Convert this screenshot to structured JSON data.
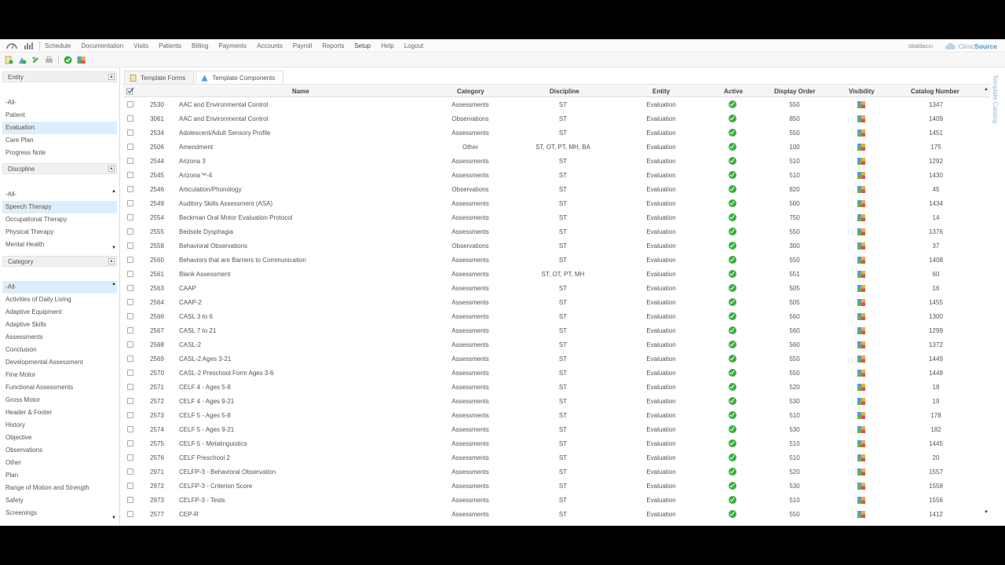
{
  "nav": {
    "items": [
      "Schedule",
      "Documentation",
      "Visits",
      "Patients",
      "Billing",
      "Payments",
      "Accounts",
      "Payroll",
      "Reports",
      "Setup",
      "Help",
      "Logout"
    ],
    "active": "Setup",
    "user": "sbaldacci",
    "brand_prefix": "Clinic",
    "brand_suffix": "Source"
  },
  "toolbar": {
    "icons": [
      "add-form-icon",
      "add-component-icon",
      "edit-icon",
      "print-icon",
      "approve-icon",
      "catalog-icon"
    ]
  },
  "left_panel": {
    "entity": {
      "header": "Entity",
      "items": [
        "-All-",
        "Patient",
        "Evaluation",
        "Care Plan",
        "Progress Note"
      ],
      "selected": "Evaluation"
    },
    "discipline": {
      "header": "Discipline",
      "items": [
        "-All-",
        "Speech Therapy",
        "Occupational Therapy",
        "Physical Therapy",
        "Mental Health"
      ],
      "selected": "Speech Therapy"
    },
    "category": {
      "header": "Category",
      "items": [
        "-All-",
        "Activities of Daily Living",
        "Adaptive Equipment",
        "Adaptive Skills",
        "Assessments",
        "Conclusion",
        "Developmental Assessment",
        "Fine Motor",
        "Functional Assessments",
        "Gross Motor",
        "Header & Footer",
        "History",
        "Objective",
        "Observations",
        "Other",
        "Plan",
        "Range of Motion and Strength",
        "Safety",
        "Screenings"
      ],
      "selected": "-All-"
    }
  },
  "tabs": [
    {
      "label": "Template Forms",
      "active": false
    },
    {
      "label": "Template Components",
      "active": true
    }
  ],
  "side_tab": "Template Catalog",
  "grid": {
    "columns": {
      "name": "Name",
      "category": "Category",
      "discipline": "Discipline",
      "entity": "Entity",
      "active": "Active",
      "display_order": "Display Order",
      "visibility": "Visibility",
      "catalog_number": "Catalog Number"
    },
    "rows": [
      {
        "id": "2530",
        "name": "AAC and Environmental Control",
        "category": "Assessments",
        "discipline": "ST",
        "entity": "Evaluation",
        "order": "550",
        "catalog": "1347"
      },
      {
        "id": "3061",
        "name": "AAC and Environmental Control",
        "category": "Observations",
        "discipline": "ST",
        "entity": "Evaluation",
        "order": "850",
        "catalog": "1409"
      },
      {
        "id": "2534",
        "name": "Adolescent/Adult Sensory Profile",
        "category": "Assessments",
        "discipline": "ST",
        "entity": "Evaluation",
        "order": "550",
        "catalog": "1451"
      },
      {
        "id": "2506",
        "name": "Amendment",
        "category": "Other",
        "discipline": "ST, OT, PT, MH, BA",
        "entity": "Evaluation",
        "order": "100",
        "catalog": "175"
      },
      {
        "id": "2544",
        "name": "Arizona 3",
        "category": "Assessments",
        "discipline": "ST",
        "entity": "Evaluation",
        "order": "510",
        "catalog": "1292"
      },
      {
        "id": "2545",
        "name": "Arizona™-4",
        "category": "Assessments",
        "discipline": "ST",
        "entity": "Evaluation",
        "order": "510",
        "catalog": "1430"
      },
      {
        "id": "2546",
        "name": "Articulation/Phonology",
        "category": "Observations",
        "discipline": "ST",
        "entity": "Evaluation",
        "order": "820",
        "catalog": "45"
      },
      {
        "id": "2549",
        "name": "Auditory Skills Assessment (ASA)",
        "category": "Assessments",
        "discipline": "ST",
        "entity": "Evaluation",
        "order": "500",
        "catalog": "1434"
      },
      {
        "id": "2554",
        "name": "Beckman Oral Motor Evaluation Protocol",
        "category": "Assessments",
        "discipline": "ST",
        "entity": "Evaluation",
        "order": "750",
        "catalog": "14"
      },
      {
        "id": "2555",
        "name": "Bedside Dysphagia",
        "category": "Assessments",
        "discipline": "ST",
        "entity": "Evaluation",
        "order": "550",
        "catalog": "1376"
      },
      {
        "id": "2558",
        "name": "Behavioral Observations",
        "category": "Observations",
        "discipline": "ST",
        "entity": "Evaluation",
        "order": "300",
        "catalog": "37"
      },
      {
        "id": "2560",
        "name": "Behaviors that are Barriers to Communication",
        "category": "Assessments",
        "discipline": "ST",
        "entity": "Evaluation",
        "order": "550",
        "catalog": "1408"
      },
      {
        "id": "2561",
        "name": "Blank Assessment",
        "category": "Assessments",
        "discipline": "ST, OT, PT, MH",
        "entity": "Evaluation",
        "order": "551",
        "catalog": "60"
      },
      {
        "id": "2563",
        "name": "CAAP",
        "category": "Assessments",
        "discipline": "ST",
        "entity": "Evaluation",
        "order": "505",
        "catalog": "16"
      },
      {
        "id": "2564",
        "name": "CAAP-2",
        "category": "Assessments",
        "discipline": "ST",
        "entity": "Evaluation",
        "order": "505",
        "catalog": "1455"
      },
      {
        "id": "2566",
        "name": "CASL 3 to 6",
        "category": "Assessments",
        "discipline": "ST",
        "entity": "Evaluation",
        "order": "560",
        "catalog": "1300"
      },
      {
        "id": "2567",
        "name": "CASL 7 to 21",
        "category": "Assessments",
        "discipline": "ST",
        "entity": "Evaluation",
        "order": "560",
        "catalog": "1299"
      },
      {
        "id": "2568",
        "name": "CASL-2",
        "category": "Assessments",
        "discipline": "ST",
        "entity": "Evaluation",
        "order": "560",
        "catalog": "1372"
      },
      {
        "id": "2569",
        "name": "CASL-2 Ages 3-21",
        "category": "Assessments",
        "discipline": "ST",
        "entity": "Evaluation",
        "order": "550",
        "catalog": "1449"
      },
      {
        "id": "2570",
        "name": "CASL-2 Preschool Form Ages 3-6",
        "category": "Assessments",
        "discipline": "ST",
        "entity": "Evaluation",
        "order": "550",
        "catalog": "1448"
      },
      {
        "id": "2571",
        "name": "CELF 4 - Ages 5-8",
        "category": "Assessments",
        "discipline": "ST",
        "entity": "Evaluation",
        "order": "520",
        "catalog": "18"
      },
      {
        "id": "2572",
        "name": "CELF 4 - Ages 9-21",
        "category": "Assessments",
        "discipline": "ST",
        "entity": "Evaluation",
        "order": "530",
        "catalog": "19"
      },
      {
        "id": "2573",
        "name": "CELF 5 - Ages 5-8",
        "category": "Assessments",
        "discipline": "ST",
        "entity": "Evaluation",
        "order": "510",
        "catalog": "178"
      },
      {
        "id": "2574",
        "name": "CELF 5 - Ages 9-21",
        "category": "Assessments",
        "discipline": "ST",
        "entity": "Evaluation",
        "order": "530",
        "catalog": "182"
      },
      {
        "id": "2575",
        "name": "CELF 5 - Metalinguistics",
        "category": "Assessments",
        "discipline": "ST",
        "entity": "Evaluation",
        "order": "510",
        "catalog": "1445"
      },
      {
        "id": "2576",
        "name": "CELF Preschool 2",
        "category": "Assessments",
        "discipline": "ST",
        "entity": "Evaluation",
        "order": "510",
        "catalog": "20"
      },
      {
        "id": "2971",
        "name": "CELFP-3 - Behavioral Observation",
        "category": "Assessments",
        "discipline": "ST",
        "entity": "Evaluation",
        "order": "520",
        "catalog": "1557"
      },
      {
        "id": "2972",
        "name": "CELFP-3 - Criterion Score",
        "category": "Assessments",
        "discipline": "ST",
        "entity": "Evaluation",
        "order": "530",
        "catalog": "1558"
      },
      {
        "id": "2973",
        "name": "CELFP-3 - Tests",
        "category": "Assessments",
        "discipline": "ST",
        "entity": "Evaluation",
        "order": "510",
        "catalog": "1556"
      },
      {
        "id": "2577",
        "name": "CEP-R",
        "category": "Assessments",
        "discipline": "ST",
        "entity": "Evaluation",
        "order": "550",
        "catalog": "1412"
      }
    ]
  },
  "colors": {
    "active_green": "#3ab03e",
    "selected_row": "#ddeefa",
    "brand_blue": "#4a90c9"
  }
}
